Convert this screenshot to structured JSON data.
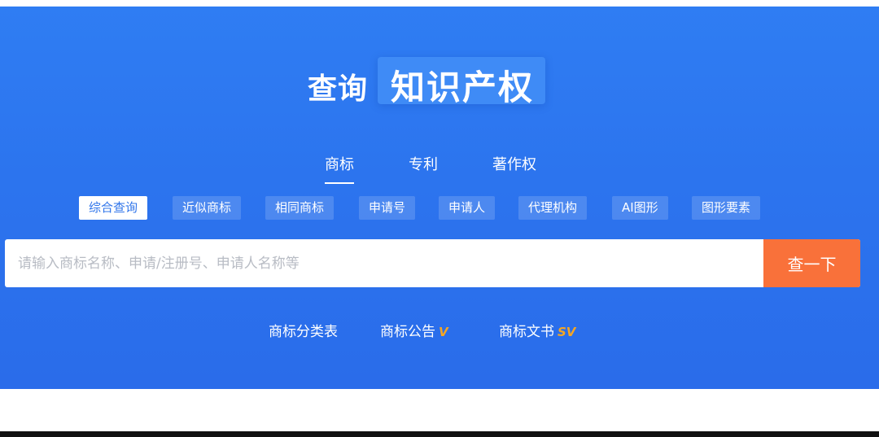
{
  "title": {
    "prefix": "查询",
    "main": "知识产权"
  },
  "tabs": [
    {
      "label": "商标",
      "active": true
    },
    {
      "label": "专利",
      "active": false
    },
    {
      "label": "著作权",
      "active": false
    }
  ],
  "subtabs": [
    {
      "label": "综合查询",
      "active": true
    },
    {
      "label": "近似商标",
      "active": false
    },
    {
      "label": "相同商标",
      "active": false
    },
    {
      "label": "申请号",
      "active": false
    },
    {
      "label": "申请人",
      "active": false
    },
    {
      "label": "代理机构",
      "active": false
    },
    {
      "label": "AI图形",
      "active": false
    },
    {
      "label": "图形要素",
      "active": false
    }
  ],
  "search": {
    "placeholder": "请输入商标名称、申请/注册号、申请人名称等",
    "value": "",
    "button_label": "查一下"
  },
  "links": [
    {
      "label": "商标分类表"
    },
    {
      "label": "商标公告",
      "badge": "V",
      "badge_color": "#f5a623"
    },
    {
      "label": "商标文书",
      "badge": "SV",
      "badge_color": "#f5a623"
    }
  ],
  "colors": {
    "hero_bg": "#2c74ee",
    "search_button": "#f9713a",
    "active_chip_text": "#2f74ea"
  }
}
